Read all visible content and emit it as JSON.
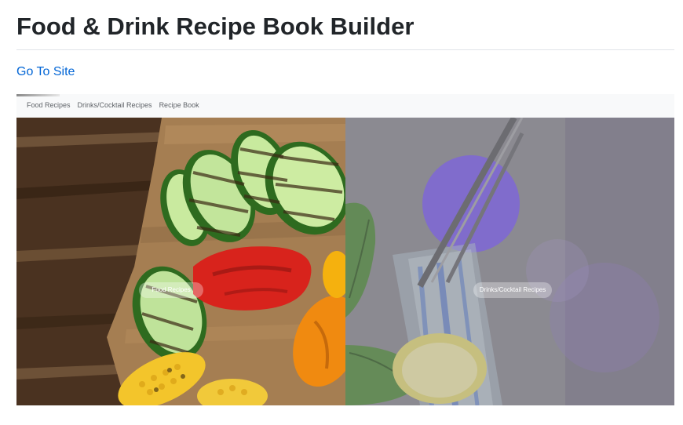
{
  "header": {
    "title": "Food & Drink Recipe Book Builder",
    "site_link": "Go To Site"
  },
  "preview": {
    "nav_items": [
      {
        "label": "Food Recipes"
      },
      {
        "label": "Drinks/Cocktail Recipes"
      },
      {
        "label": "Recipe Book"
      }
    ],
    "panels": {
      "food": {
        "button_label": "Food Recipes"
      },
      "drinks": {
        "button_label": "Drinks/Cocktail Recipes"
      }
    }
  },
  "colors": {
    "title": "#212529",
    "link": "#0366d6",
    "nav_background": "#f8f9fa",
    "drinks_overlay": "#8a8a8a",
    "accent_purple": "#7b5cf0"
  }
}
